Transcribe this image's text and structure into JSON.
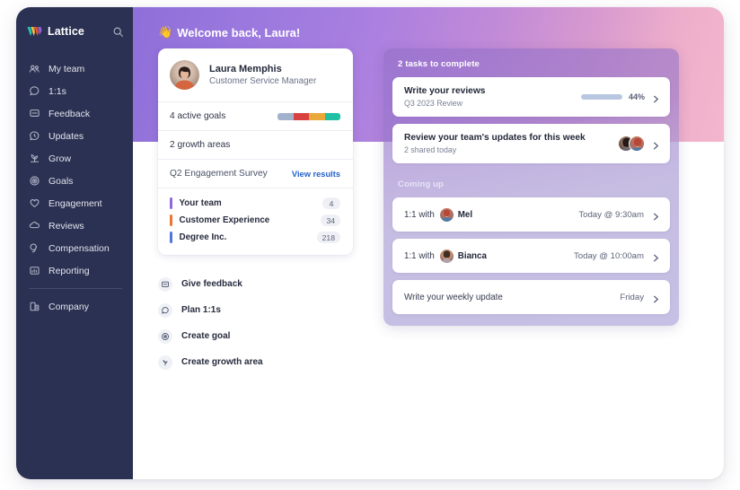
{
  "brand": {
    "name": "Lattice",
    "logo_icon": "lattice-logo-icon",
    "search_icon": "search-icon",
    "logo_colors": [
      "#2ec4b6",
      "#f4c13c",
      "#e8543f",
      "#8e66d6"
    ]
  },
  "sidebar": {
    "items": [
      {
        "label": "My team",
        "icon": "people-icon"
      },
      {
        "label": "1:1s",
        "icon": "chat-bubble-icon"
      },
      {
        "label": "Feedback",
        "icon": "message-square-icon"
      },
      {
        "label": "Updates",
        "icon": "clock-bubble-icon"
      },
      {
        "label": "Grow",
        "icon": "plant-icon"
      },
      {
        "label": "Goals",
        "icon": "target-icon"
      },
      {
        "label": "Engagement",
        "icon": "heart-icon"
      },
      {
        "label": "Reviews",
        "icon": "cloud-icon"
      },
      {
        "label": "Compensation",
        "icon": "coins-icon"
      },
      {
        "label": "Reporting",
        "icon": "report-icon"
      }
    ],
    "divider_after_index": 9,
    "footer_items": [
      {
        "label": "Company",
        "icon": "building-icon"
      }
    ]
  },
  "header": {
    "wave_icon": "waving-hand-icon",
    "greeting": "Welcome back, Laura!"
  },
  "profile": {
    "avatar": "user-avatar-photo",
    "name": "Laura Memphis",
    "role": "Customer Service Manager",
    "goals_row": {
      "label": "4 active goals",
      "segments": [
        "#a3b2cc",
        "#d94141",
        "#e8a93a",
        "#1fc0a4"
      ]
    },
    "growth_row": {
      "label": "2 growth areas"
    },
    "survey_row": {
      "label": "Q2 Engagement Survey",
      "action_label": "View results"
    },
    "survey_items": [
      {
        "label": "Your team",
        "count": "4",
        "color": "#8e6ad8"
      },
      {
        "label": "Customer Experience",
        "count": "34",
        "color": "#f0762f"
      },
      {
        "label": "Degree Inc.",
        "count": "218",
        "color": "#4f77d8"
      }
    ]
  },
  "quick_actions": [
    {
      "label": "Give feedback",
      "icon": "message-square-icon"
    },
    {
      "label": "Plan 1:1s",
      "icon": "chat-bubble-icon"
    },
    {
      "label": "Create goal",
      "icon": "target-icon"
    },
    {
      "label": "Create growth area",
      "icon": "plant-icon"
    }
  ],
  "tasks_panel": {
    "heading": "2 tasks to complete",
    "tasks": [
      {
        "title": "Write your reviews",
        "subtitle": "Q3 2023 Review",
        "progress_pct": "44%",
        "progress_value": 44,
        "chevron_icon": "chevron-right-icon"
      },
      {
        "title": "Review your team's updates for this week",
        "subtitle": "2 shared today",
        "avatars": [
          "teammate-avatar-1",
          "teammate-avatar-2"
        ],
        "chevron_icon": "chevron-right-icon"
      }
    ],
    "coming_up_heading": "Coming up",
    "coming_up": [
      {
        "prefix": "1:1 with",
        "person": "Mel",
        "avatar": "mel-avatar",
        "time": "Today @ 9:30am",
        "chevron_icon": "chevron-right-icon"
      },
      {
        "prefix": "1:1 with",
        "person": "Bianca",
        "avatar": "bianca-avatar",
        "time": "Today @ 10:00am",
        "chevron_icon": "chevron-right-icon"
      },
      {
        "plain_label": "Write your weekly update",
        "time": "Friday",
        "chevron_icon": "chevron-right-icon"
      }
    ]
  },
  "theme": {
    "sidebar_bg": "#2b3152",
    "gradient_start": "#8f6fd8",
    "gradient_end": "#f3b6cc",
    "accent_blue": "#2563c9",
    "progress_blue": "#0f55ad"
  }
}
